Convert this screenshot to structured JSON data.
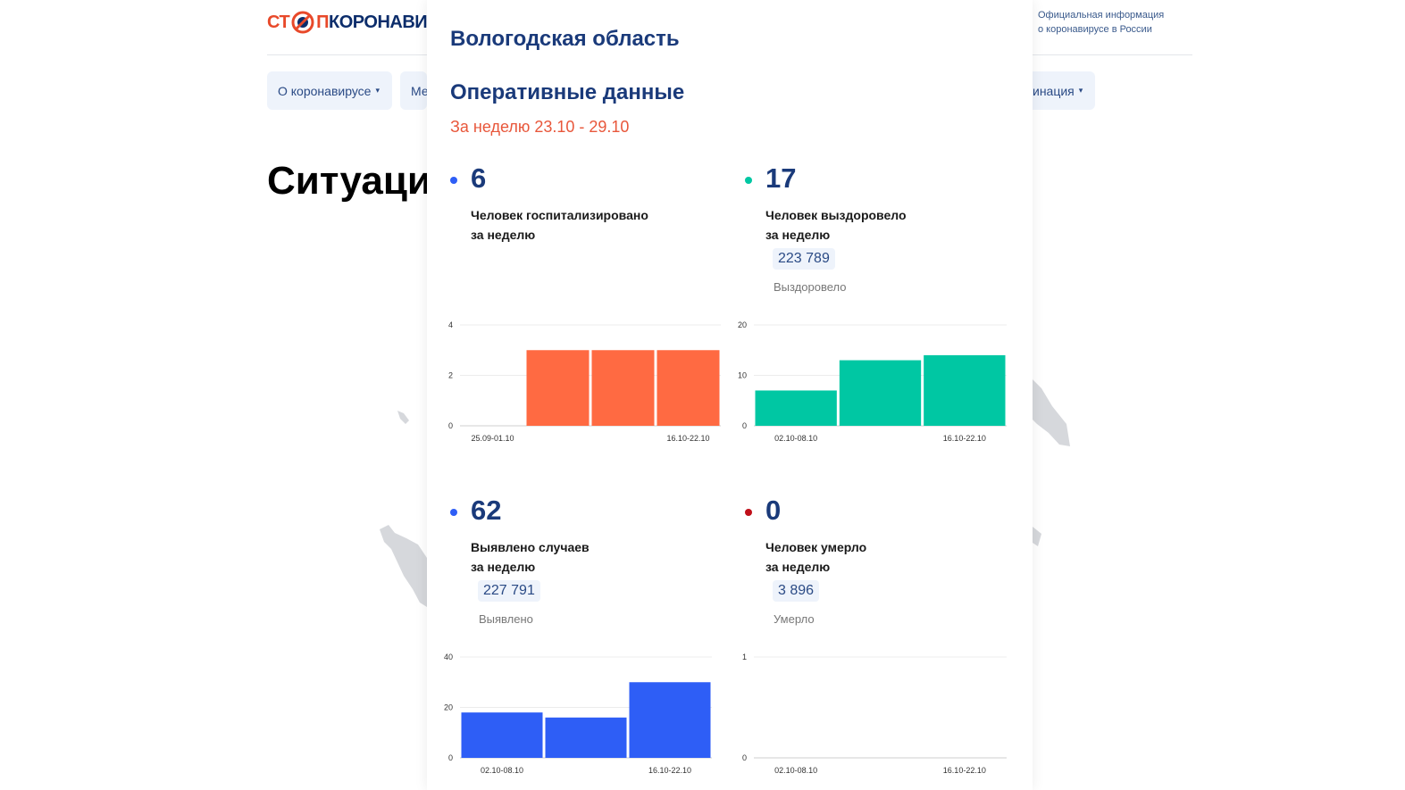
{
  "site": {
    "logo_part1": "СТ",
    "logo_part2": "П",
    "logo_part3": "КОРОНАВИ",
    "official_line1": "Официальная информация",
    "official_line2": "о коронавирусе в России",
    "nav": [
      {
        "label": "О коронавирусе",
        "arrow": "▾"
      },
      {
        "label": "Ме",
        "arrow": ""
      },
      {
        "label": "инация",
        "arrow": "▾"
      }
    ],
    "headline": "Ситуаци"
  },
  "modal": {
    "region": "Вологодская область",
    "section": "Оперативные данные",
    "period": "За неделю 23.10 - 29.10"
  },
  "colors": {
    "hospitalized": "#ff6a42",
    "recovered": "#00c7a3",
    "cases": "#2e5ef6",
    "deaths": "#c0101a",
    "dark_blue": "#1a3a7a",
    "accent_red": "#e8573b"
  },
  "stats": {
    "hospitalized": {
      "number": "6",
      "desc_line1": "Человек госпитализировано",
      "desc_line2": "за неделю"
    },
    "recovered": {
      "number": "17",
      "desc_line1": "Человек выздоровело",
      "desc_line2": "за неделю",
      "total": "223 789",
      "total_label": "Выздоровело"
    },
    "cases": {
      "number": "62",
      "desc_line1": "Выявлено случаев",
      "desc_line2": "за неделю",
      "total": "227 791",
      "total_label": "Выявлено"
    },
    "deaths": {
      "number": "0",
      "desc_line1": "Человек умерло",
      "desc_line2": "за неделю",
      "total": "3 896",
      "total_label": "Умерло"
    }
  },
  "chart_data": [
    {
      "id": "hospitalized",
      "type": "bar",
      "color": "#ff6a42",
      "values": [
        0,
        3,
        3,
        3
      ],
      "ylim": [
        0,
        4
      ],
      "yticks": [
        0,
        2,
        4
      ],
      "xtick_labels": [
        {
          "index": 0,
          "label": "25.09-01.10"
        },
        {
          "index": 3,
          "label": "16.10-22.10"
        }
      ]
    },
    {
      "id": "recovered",
      "type": "bar",
      "color": "#00c7a3",
      "values": [
        7,
        13,
        14
      ],
      "ylim": [
        0,
        20
      ],
      "yticks": [
        0,
        10,
        20
      ],
      "xtick_labels": [
        {
          "index": 0,
          "label": "02.10-08.10"
        },
        {
          "index": 2,
          "label": "16.10-22.10"
        }
      ]
    },
    {
      "id": "cases",
      "type": "bar",
      "color": "#2e5ef6",
      "values": [
        18,
        16,
        30
      ],
      "ylim": [
        0,
        40
      ],
      "yticks": [
        0,
        20,
        40
      ],
      "xtick_labels": [
        {
          "index": 0,
          "label": "02.10-08.10"
        },
        {
          "index": 2,
          "label": "16.10-22.10"
        }
      ]
    },
    {
      "id": "deaths",
      "type": "bar",
      "color": "#c0101a",
      "values": [
        0,
        0,
        0
      ],
      "ylim": [
        0,
        1
      ],
      "yticks": [
        0,
        1
      ],
      "xtick_labels": [
        {
          "index": 0,
          "label": "02.10-08.10"
        },
        {
          "index": 2,
          "label": "16.10-22.10"
        }
      ]
    }
  ]
}
